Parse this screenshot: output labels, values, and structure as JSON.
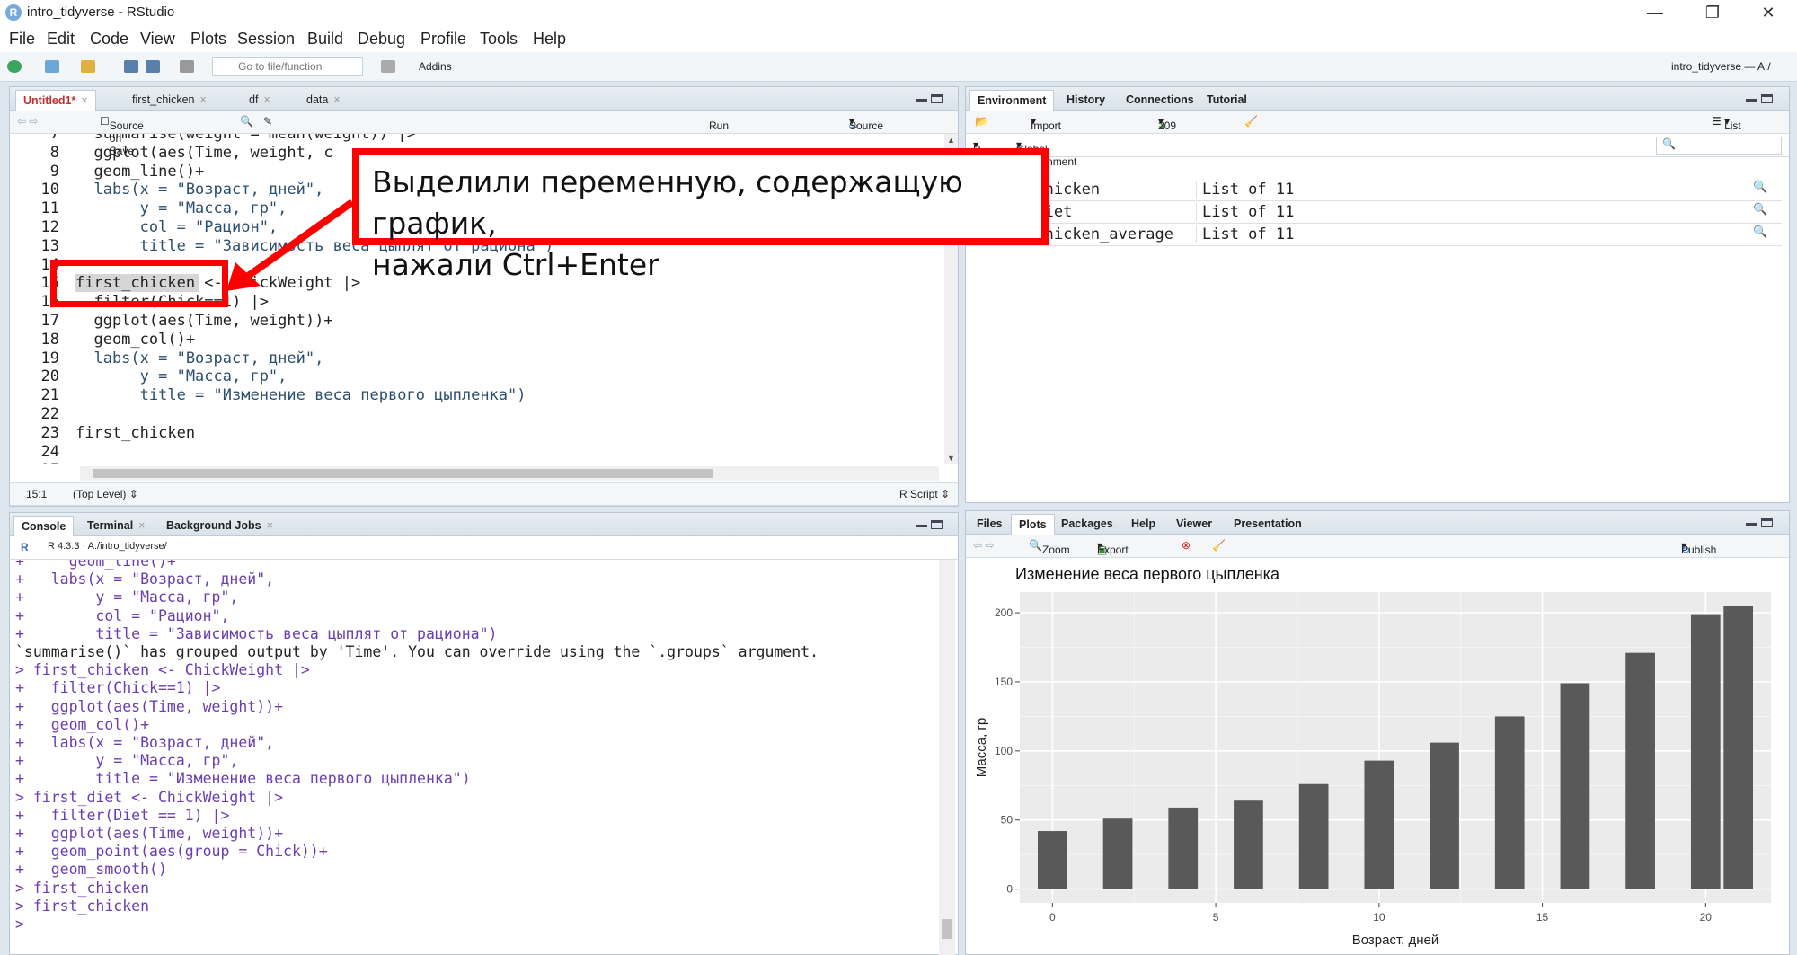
{
  "window": {
    "title": "intro_tidyverse - RStudio",
    "r_logo": "R",
    "controls": [
      "—",
      "❐",
      "✕"
    ]
  },
  "menu": [
    "File",
    "Edit",
    "Code",
    "View",
    "Plots",
    "Session",
    "Build",
    "Debug",
    "Profile",
    "Tools",
    "Help"
  ],
  "toolbar": {
    "goto_placeholder": "Go to file/function",
    "addins_label": "Addins",
    "project_label": "intro_tidyverse — A:/"
  },
  "editor": {
    "tabs": [
      "Untitled1*",
      "first_chicken",
      "df",
      "data"
    ],
    "source_on_save": "Source on Save",
    "run_label": "Run",
    "source_label": "Source",
    "lines": [
      {
        "n": "7",
        "text": "  summarise(weight = mean(weight)) |>"
      },
      {
        "n": "8",
        "text": "  ggplot(aes(Time, weight, c"
      },
      {
        "n": "9",
        "text": "  geom_line()+"
      },
      {
        "n": "10",
        "text": "  labs(x = \"Возраст, дней\","
      },
      {
        "n": "11",
        "text": "       y = \"Масса, гр\","
      },
      {
        "n": "12",
        "text": "       col = \"Рацион\","
      },
      {
        "n": "13",
        "text": "       title = \"Зависимость веса цыплят от рациона\")"
      },
      {
        "n": "14",
        "text": ""
      },
      {
        "n": "15",
        "text": "first_chicken <- ChickWeight |>"
      },
      {
        "n": "16",
        "text": "  filter(Chick==1) |>"
      },
      {
        "n": "17",
        "text": "  ggplot(aes(Time, weight))+"
      },
      {
        "n": "18",
        "text": "  geom_col()+"
      },
      {
        "n": "19",
        "text": "  labs(x = \"Возраст, дней\","
      },
      {
        "n": "20",
        "text": "       y = \"Масса, гр\","
      },
      {
        "n": "21",
        "text": "       title = \"Изменение веса первого цыпленка\")"
      },
      {
        "n": "22",
        "text": ""
      },
      {
        "n": "23",
        "text": "first_chicken"
      },
      {
        "n": "24",
        "text": ""
      },
      {
        "n": "25",
        "text": ""
      }
    ],
    "status_pos": "15:1",
    "status_scope": "(Top Level) ⇕",
    "status_type": "R Script ⇕"
  },
  "environment": {
    "tabs": [
      "Environment",
      "History",
      "Connections",
      "Tutorial"
    ],
    "import_label": "Import Dataset",
    "memory_label": "209 MiB",
    "list_label": "List",
    "scope_label": "Global Environment",
    "lang": "R",
    "rows": [
      {
        "name": "first_chicken",
        "value": "List of  11"
      },
      {
        "name": "first_diet",
        "value": "List of  11"
      },
      {
        "name": "first_chicken_average",
        "value": "List of  11"
      }
    ]
  },
  "console": {
    "tabs": [
      "Console",
      "Terminal",
      "Background Jobs"
    ],
    "version": "R 4.3.3 · A:/intro_tidyverse/",
    "lines": [
      {
        "p": "+",
        "t": "    geom_line()+",
        "c": "p"
      },
      {
        "p": "+",
        "t": "  labs(x = \"Возраст, дней\",",
        "c": "p"
      },
      {
        "p": "+",
        "t": "       y = \"Масса, гр\",",
        "c": "p"
      },
      {
        "p": "+",
        "t": "       col = \"Рацион\",",
        "c": "p"
      },
      {
        "p": "+",
        "t": "       title = \"Зависимость веса цыплят от рациона\")",
        "c": "p"
      },
      {
        "p": "",
        "t": "`summarise()` has grouped output by 'Time'. You can override using the `.groups` argument.",
        "c": "o"
      },
      {
        "p": ">",
        "t": "first_chicken <- ChickWeight |>",
        "c": "p"
      },
      {
        "p": "+",
        "t": "  filter(Chick==1) |>",
        "c": "p"
      },
      {
        "p": "+",
        "t": "  ggplot(aes(Time, weight))+",
        "c": "p"
      },
      {
        "p": "+",
        "t": "  geom_col()+",
        "c": "p"
      },
      {
        "p": "+",
        "t": "  labs(x = \"Возраст, дней\",",
        "c": "p"
      },
      {
        "p": "+",
        "t": "       y = \"Масса, гр\",",
        "c": "p"
      },
      {
        "p": "+",
        "t": "       title = \"Изменение веса первого цыпленка\")",
        "c": "p"
      },
      {
        "p": ">",
        "t": "first_diet <- ChickWeight |>",
        "c": "p"
      },
      {
        "p": "+",
        "t": "  filter(Diet == 1) |>",
        "c": "p"
      },
      {
        "p": "+",
        "t": "  ggplot(aes(Time, weight))+",
        "c": "p"
      },
      {
        "p": "+",
        "t": "  geom_point(aes(group = Chick))+",
        "c": "p"
      },
      {
        "p": "+",
        "t": "  geom_smooth()",
        "c": "p"
      },
      {
        "p": ">",
        "t": "first_chicken",
        "c": "p"
      },
      {
        "p": ">",
        "t": "first_chicken",
        "c": "p"
      },
      {
        "p": ">",
        "t": "",
        "c": "p"
      }
    ]
  },
  "files": {
    "tabs": [
      "Files",
      "Plots",
      "Packages",
      "Help",
      "Viewer",
      "Presentation"
    ],
    "zoom_label": "Zoom",
    "export_label": "Export",
    "publish_label": "Publish"
  },
  "callout": {
    "line1": "Выделили переменную, содержащую график,",
    "line2": "нажали Ctrl+Enter"
  },
  "chart_data": {
    "type": "bar",
    "title": "Изменение веса первого цыпленка",
    "xlabel": "Возраст, дней",
    "ylabel": "Масса, гр",
    "x": [
      0,
      2,
      4,
      6,
      8,
      10,
      12,
      14,
      16,
      18,
      20,
      21
    ],
    "values": [
      42,
      51,
      59,
      64,
      76,
      93,
      106,
      125,
      149,
      171,
      199,
      205
    ],
    "xlim": [
      -1,
      22
    ],
    "ylim": [
      -10,
      215
    ],
    "xticks": [
      "0",
      "5",
      "10",
      "15",
      "20"
    ],
    "yticks": [
      "0",
      "50",
      "100",
      "150",
      "200"
    ],
    "bar_color": "#595959",
    "panel_color": "#ebebeb",
    "grid": true
  }
}
